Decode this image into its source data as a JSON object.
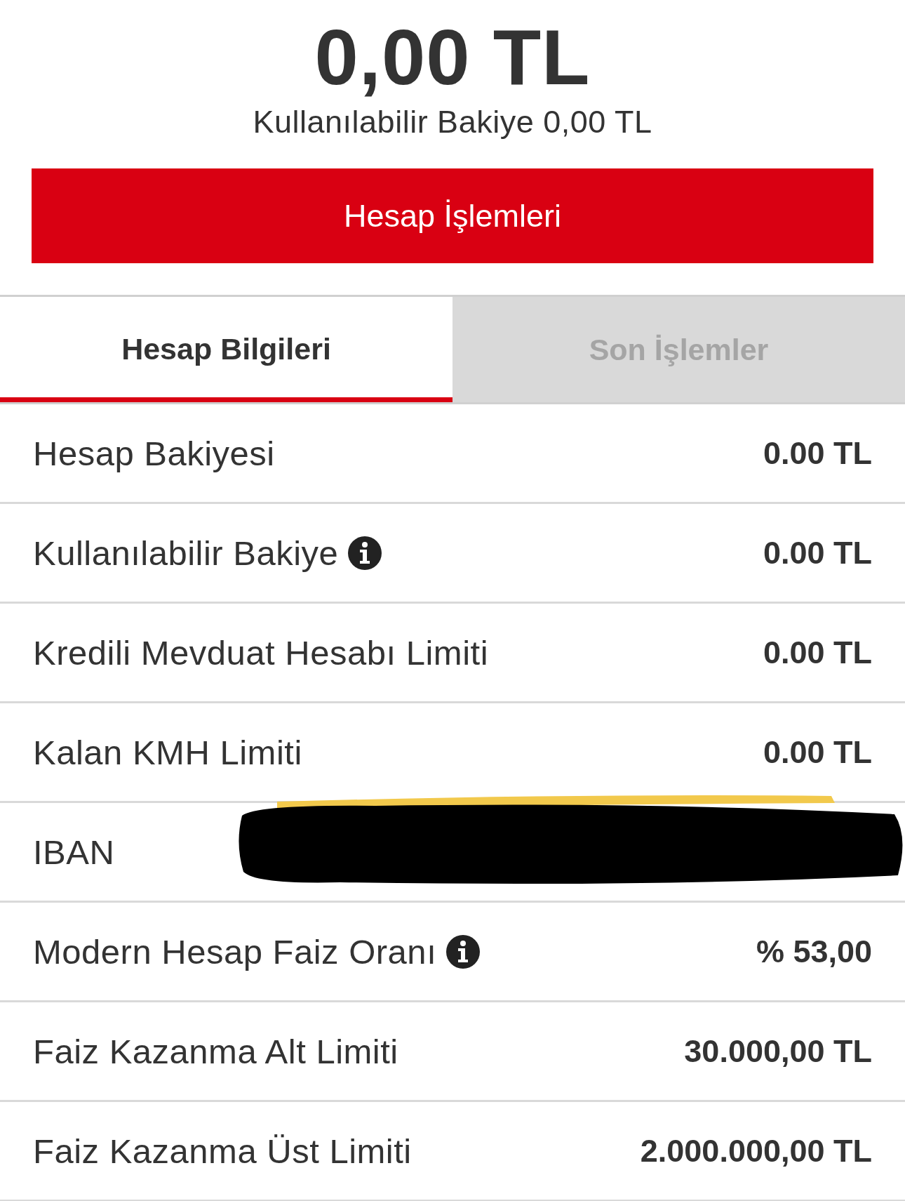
{
  "balance": {
    "amount": "0,00 TL",
    "available": "Kullanılabilir Bakiye 0,00 TL"
  },
  "action_button": {
    "label": "Hesap İşlemleri"
  },
  "tabs": [
    {
      "label": "Hesap Bilgileri",
      "selected": true
    },
    {
      "label": "Son İşlemler",
      "selected": false
    }
  ],
  "rows": [
    {
      "label": "Hesap Bakiyesi",
      "value": "0.00 TL",
      "info": false
    },
    {
      "label": "Kullanılabilir Bakiye",
      "value": "0.00 TL",
      "info": true
    },
    {
      "label": "Kredili Mevduat Hesabı Limiti",
      "value": "0.00 TL",
      "info": false
    },
    {
      "label": "Kalan KMH Limiti",
      "value": "0.00 TL",
      "info": false
    },
    {
      "label": "IBAN",
      "redacted": true,
      "info": false
    },
    {
      "label": "Modern Hesap Faiz Oranı",
      "value": "% 53,00",
      "info": true
    },
    {
      "label": "Faiz Kazanma Alt Limiti",
      "value": "30.000,00 TL",
      "info": false
    },
    {
      "label": "Faiz Kazanma Üst Limiti",
      "value": "2.000.000,00 TL",
      "info": false
    }
  ]
}
